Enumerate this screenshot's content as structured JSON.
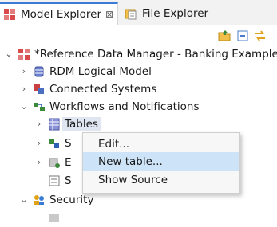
{
  "tabs": [
    {
      "label": "Model Explorer",
      "icon": "model-explorer-icon",
      "close": "⊠"
    },
    {
      "label": "File Explorer",
      "icon": "file-explorer-icon"
    }
  ],
  "toolbar": {
    "icons": [
      "open-folder-icon",
      "collapse-all-icon",
      "link-editor-icon"
    ]
  },
  "tree": {
    "root": {
      "label": "*Reference Data Manager - Banking Example",
      "icon": "project-icon"
    },
    "items": [
      {
        "label": "RDM Logical Model",
        "icon": "database-icon"
      },
      {
        "label": "Connected Systems",
        "icon": "connected-systems-icon"
      },
      {
        "label": "Workflows and Notifications",
        "icon": "workflow-icon"
      },
      {
        "label": "Tables",
        "icon": "table-icon"
      },
      {
        "label": "S",
        "icon": "node-icon"
      },
      {
        "label": "E",
        "icon": "node-icon"
      },
      {
        "label": "S",
        "icon": "node-icon"
      },
      {
        "label": "Security",
        "icon": "users-icon"
      }
    ]
  },
  "context_menu": {
    "items": [
      {
        "label": "Edit..."
      },
      {
        "label": "New table..."
      },
      {
        "label": "Show Source"
      }
    ],
    "highlighted": "New table..."
  },
  "colors": {
    "accent": "#3a7bd5",
    "selection": "#dfe6f1",
    "menu_highlight": "#cde3f8"
  }
}
